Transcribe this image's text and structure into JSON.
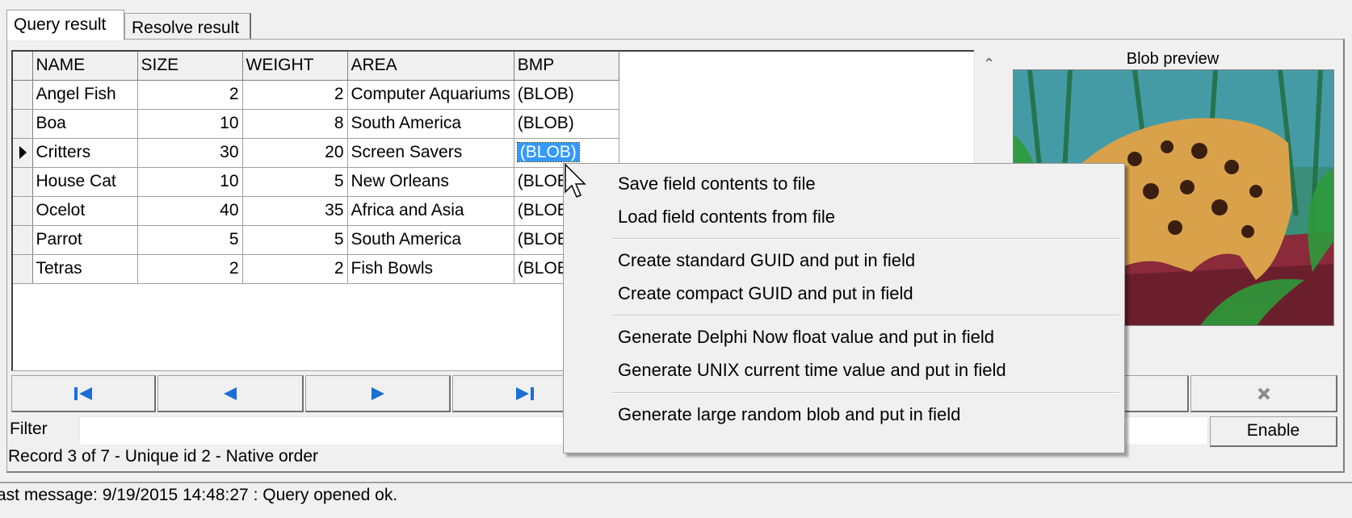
{
  "tabs": [
    {
      "label": "Query result",
      "active": true
    },
    {
      "label": "Resolve result",
      "active": false
    }
  ],
  "grid": {
    "columns": [
      "NAME",
      "SIZE",
      "WEIGHT",
      "AREA",
      "BMP"
    ],
    "rows": [
      {
        "name": "Angel Fish",
        "size": "2",
        "weight": "2",
        "area": "Computer Aquariums",
        "bmp": "(BLOB)"
      },
      {
        "name": "Boa",
        "size": "10",
        "weight": "8",
        "area": "South America",
        "bmp": "(BLOB)"
      },
      {
        "name": "Critters",
        "size": "30",
        "weight": "20",
        "area": "Screen Savers",
        "bmp": "(BLOB)"
      },
      {
        "name": "House Cat",
        "size": "10",
        "weight": "5",
        "area": "New Orleans",
        "bmp": "(BLOB)"
      },
      {
        "name": "Ocelot",
        "size": "40",
        "weight": "35",
        "area": "Africa and Asia",
        "bmp": "(BLOB)"
      },
      {
        "name": "Parrot",
        "size": "5",
        "weight": "5",
        "area": "South America",
        "bmp": "(BLOB)"
      },
      {
        "name": "Tetras",
        "size": "2",
        "weight": "2",
        "area": "Fish Bowls",
        "bmp": "(BLOB)"
      }
    ],
    "current_row": 3
  },
  "navigator": {
    "icons": [
      "first-record-icon",
      "prior-record-icon",
      "next-record-icon",
      "last-record-icon",
      "cancel-icon"
    ]
  },
  "filter": {
    "label": "Filter",
    "value": "",
    "enable_label": "Enable"
  },
  "record_status": "Record 3 of 7 - Unique id 2 - Native order",
  "blob_preview": {
    "label": "Blob preview"
  },
  "status_bar": {
    "message": "ast message: 9/19/2015 14:48:27 : Query opened ok."
  },
  "context_menu": {
    "items": [
      "Save field contents to file",
      "Load field contents from file",
      "Create standard GUID and put in field",
      "Create compact GUID and put in field",
      "Generate Delphi Now float value and put in field",
      "Generate UNIX current time value and put in field",
      "Generate large random blob and put in field"
    ]
  },
  "colors": {
    "selection": "#3399ff",
    "nav_arrow": "#1a6fd6",
    "face": "#f0f0f0"
  }
}
